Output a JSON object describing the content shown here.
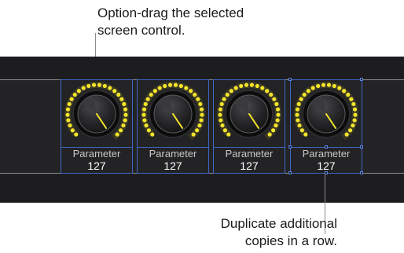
{
  "callouts": {
    "top": [
      "Option-drag the selected",
      "screen control."
    ],
    "bottom": [
      "Duplicate additional",
      "copies in a row."
    ]
  },
  "controls": [
    {
      "name": "Parameter",
      "value": "127",
      "selected": false
    },
    {
      "name": "Parameter",
      "value": "127",
      "selected": false
    },
    {
      "name": "Parameter",
      "value": "127",
      "selected": false
    },
    {
      "name": "Parameter",
      "value": "127",
      "selected": true
    }
  ],
  "colors": {
    "panel_background": "#1d1d1f",
    "led_ring": "#f5e52a",
    "selection_outline": "#3f67c8",
    "guide_line": "#8c8c8c"
  },
  "icons": {
    "knob": "rotary-knob-icon"
  }
}
